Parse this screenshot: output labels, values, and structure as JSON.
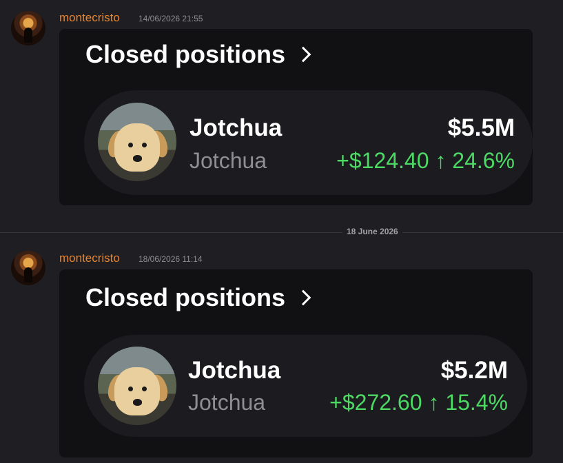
{
  "messages": [
    {
      "username": "montecristo",
      "timestamp": "14/06/2026 21:55",
      "embed": {
        "title": "Closed positions",
        "position": {
          "name": "Jotchua",
          "subtitle": "Jotchua",
          "value": "$5.5M",
          "gain": "+$124.40 ↑ 24.6%"
        }
      }
    },
    {
      "username": "montecristo",
      "timestamp": "18/06/2026 11:14",
      "embed": {
        "title": "Closed positions",
        "position": {
          "name": "Jotchua",
          "subtitle": "Jotchua",
          "value": "$5.2M",
          "gain": "+$272.60 ↑ 15.4%"
        }
      }
    }
  ],
  "date_divider": "18 June 2026",
  "colors": {
    "background": "#1f1f23",
    "username": "#e8852c",
    "gain_green": "#4cd964",
    "embed_bg": "#111114",
    "card_bg": "#1c1c20"
  },
  "icons": {
    "title_chevron": "chevron-right-icon",
    "avatar": "user-avatar",
    "token_image": "dog-token-image"
  }
}
